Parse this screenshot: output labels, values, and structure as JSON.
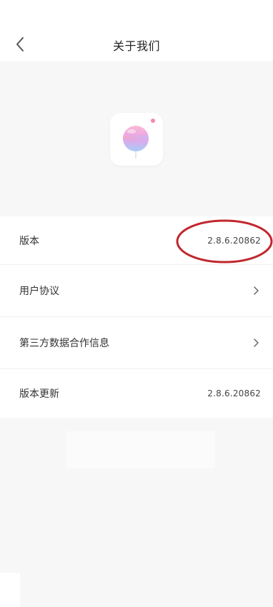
{
  "header": {
    "title": "关于我们"
  },
  "about_list": {
    "items": [
      {
        "label": "版本",
        "value": "2.8.6.20862"
      },
      {
        "label": "用户协议"
      },
      {
        "label": "第三方数据合作信息"
      },
      {
        "label": "版本更新",
        "value": "2.8.6.20862"
      }
    ]
  },
  "icons": {
    "back": "chevron-left-icon",
    "logo": "lollipop-app-logo",
    "row_arrow": "chevron-right-icon"
  },
  "colors": {
    "annotation": "#c0272d",
    "background": "#f7f7f7",
    "card": "#ffffff",
    "logo_pink": "#f59cc0",
    "logo_blue": "#9ec8f5",
    "logo_dot": "#f58aa5"
  }
}
